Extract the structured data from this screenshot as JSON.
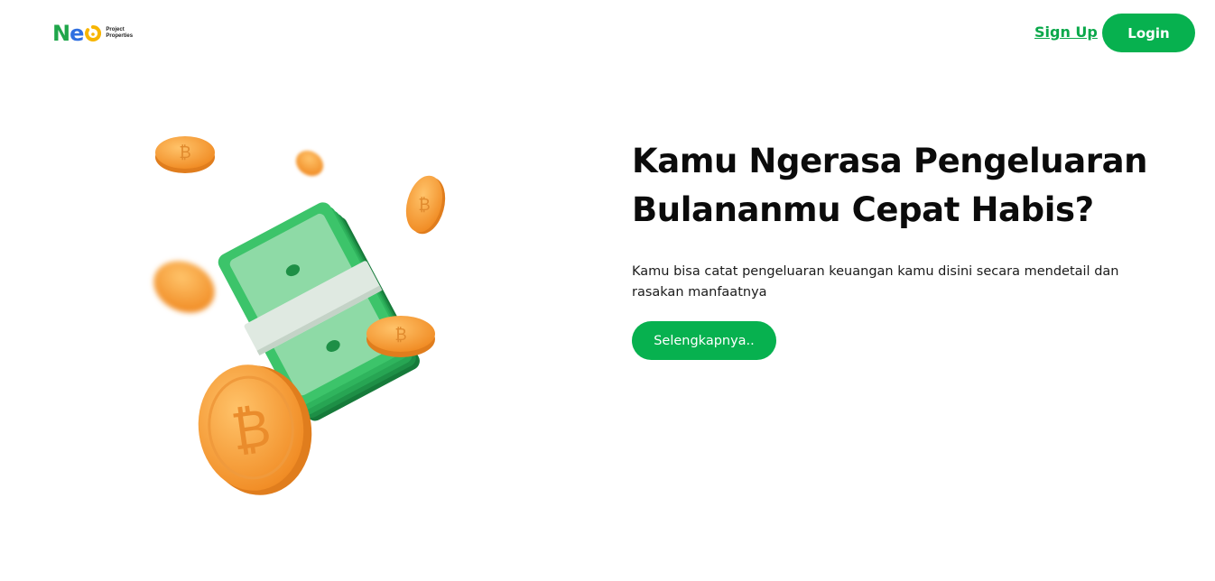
{
  "brand": {
    "logo_text_n": "N",
    "logo_text_e": "e",
    "sub_line1": "Project",
    "sub_line2": "Properties"
  },
  "nav": {
    "signup_label": "Sign Up",
    "login_label": "Login"
  },
  "hero": {
    "headline_line1": "Kamu Ngerasa Pengeluaran",
    "headline_line2": "Bulananmu Cepat Habis?",
    "description_line1": "Kamu bisa catat pengeluaran keuangan kamu disini secara mendetail dan",
    "description_line2": "rasakan manfaatnya",
    "cta_label": "Selengkapnya.."
  },
  "colors": {
    "accent_green": "#07b14f",
    "logo_blue": "#2f6fe0",
    "logo_yellow": "#f7b500",
    "coin_orange": "#f7a33c",
    "cash_green": "#1f9a4a"
  },
  "illustration": {
    "icon": "money-and-coins-illustration"
  }
}
